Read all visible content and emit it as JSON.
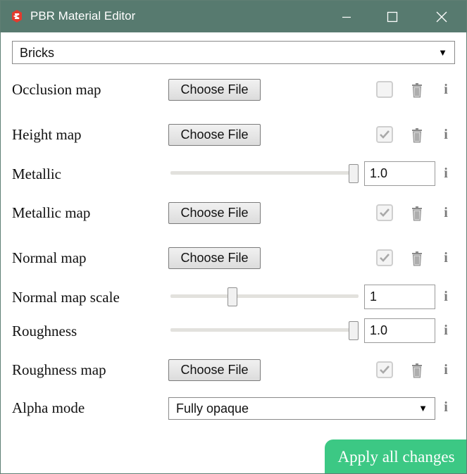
{
  "window": {
    "title": "PBR Material Editor",
    "icon": "sketchup-logo-icon",
    "accent": "#577a6f"
  },
  "material": {
    "selected": "Bricks",
    "arrow": "▼"
  },
  "rows": {
    "occlusion": {
      "label": "Occlusion map",
      "button": "Choose File",
      "checked": false
    },
    "height": {
      "label": "Height map",
      "button": "Choose File",
      "checked": true
    },
    "metallic": {
      "label": "Metallic",
      "value": "1.0",
      "slider_fraction": 1.0
    },
    "metallic_map": {
      "label": "Metallic map",
      "button": "Choose File",
      "checked": true
    },
    "normal": {
      "label": "Normal map",
      "button": "Choose File",
      "checked": true
    },
    "normal_scale": {
      "label": "Normal map scale",
      "value": "1",
      "slider_fraction": 0.32
    },
    "roughness": {
      "label": "Roughness",
      "value": "1.0",
      "slider_fraction": 1.0
    },
    "roughness_map": {
      "label": "Roughness map",
      "button": "Choose File",
      "checked": true
    },
    "alpha_mode": {
      "label": "Alpha mode",
      "selected": "Fully opaque",
      "arrow": "▼"
    }
  },
  "info_glyph": "i",
  "apply": {
    "label": "Apply all changes",
    "color": "#3cc884"
  }
}
